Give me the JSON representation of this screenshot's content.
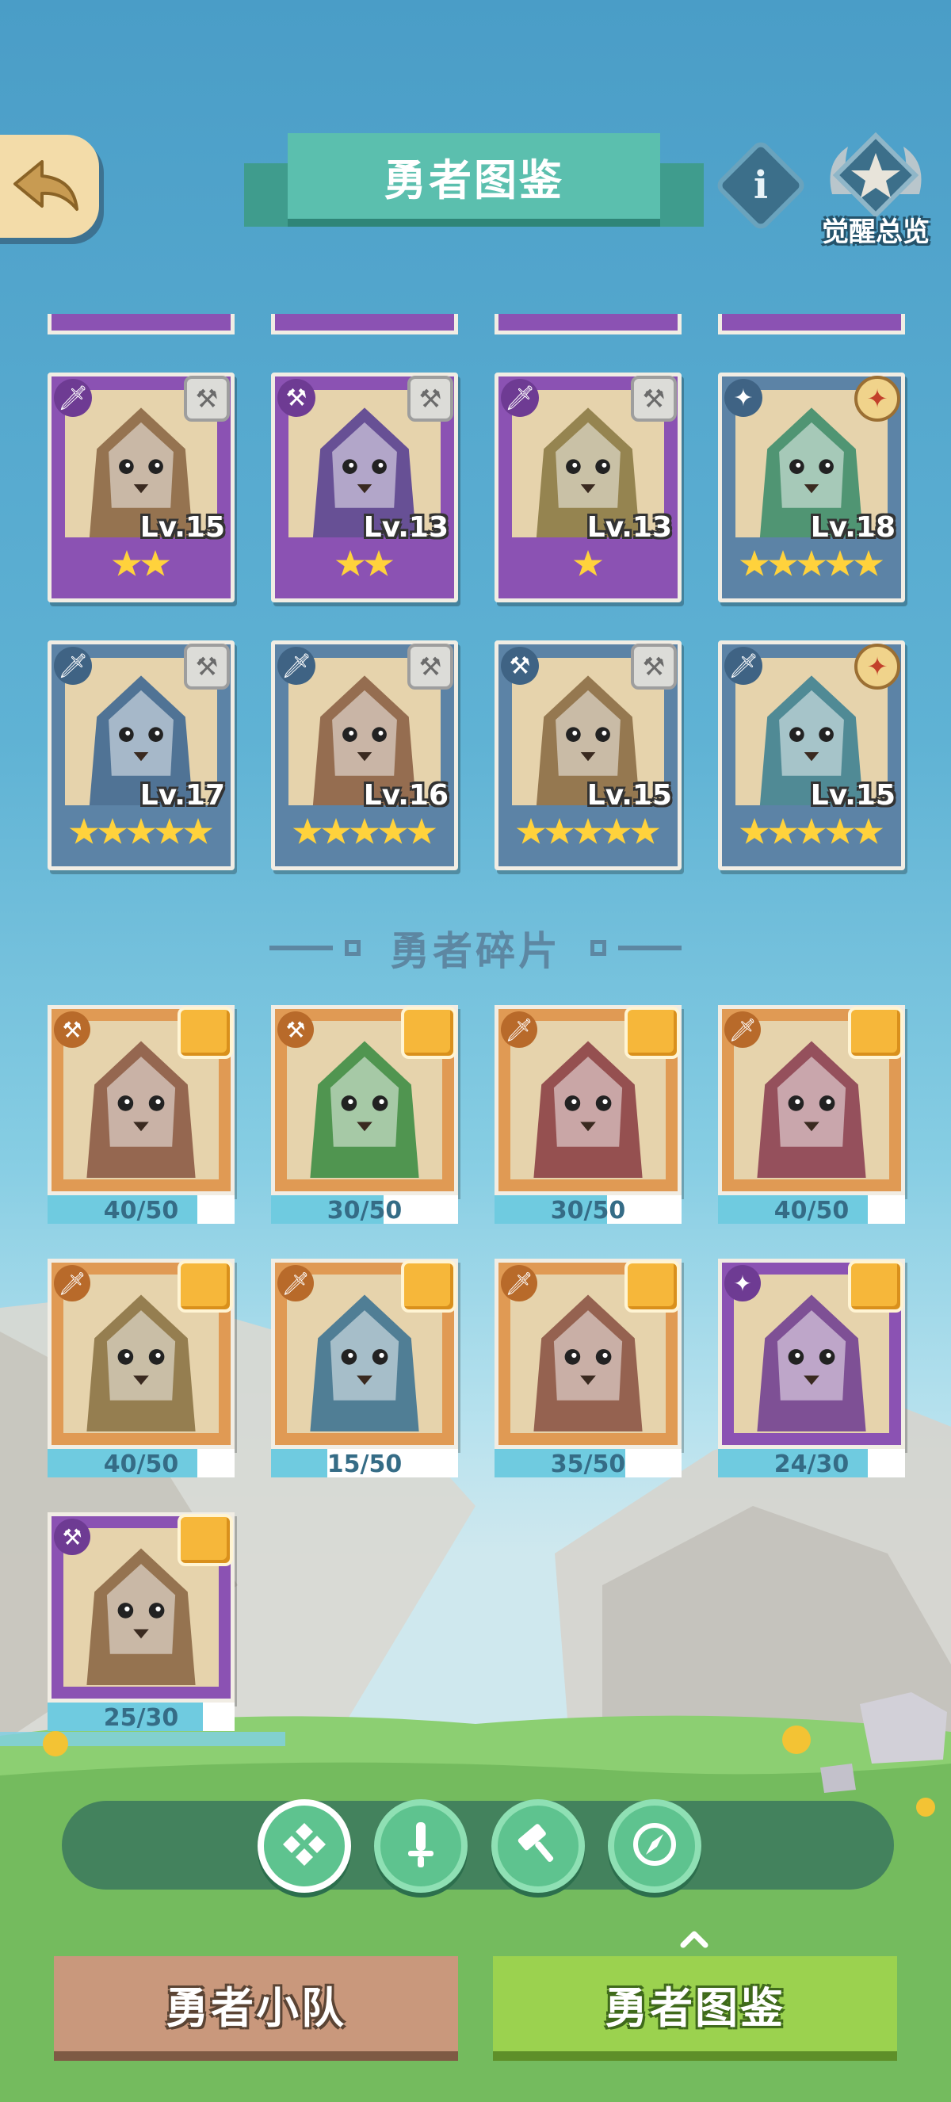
{
  "header": {
    "title": "勇者图鉴",
    "awaken_label": "觉醒总览",
    "info_glyph": "i"
  },
  "heroes": [
    {
      "level": "Lv.15",
      "stars": 2,
      "frame": "purple",
      "role": "sword",
      "weapon": "hammer",
      "portrait": "sheep-hero"
    },
    {
      "level": "Lv.13",
      "stars": 2,
      "frame": "purple",
      "role": "hammer",
      "weapon": "hammer",
      "portrait": "rhino-hero"
    },
    {
      "level": "Lv.13",
      "stars": 1,
      "frame": "purple",
      "role": "sword",
      "weapon": "hammer",
      "portrait": "goat-hero"
    },
    {
      "level": "Lv.18",
      "stars": 5,
      "frame": "blue",
      "role": "compass",
      "weapon": "compass",
      "portrait": "frog-hero"
    },
    {
      "level": "Lv.17",
      "stars": 5,
      "frame": "blue",
      "role": "sword",
      "weapon": "hammer",
      "portrait": "rabbit-hero"
    },
    {
      "level": "Lv.16",
      "stars": 5,
      "frame": "blue",
      "role": "sword",
      "weapon": "hammer",
      "portrait": "fox-hero"
    },
    {
      "level": "Lv.15",
      "stars": 5,
      "frame": "blue",
      "role": "hammer",
      "weapon": "hammer",
      "portrait": "deer-hero"
    },
    {
      "level": "Lv.15",
      "stars": 5,
      "frame": "blue",
      "role": "sword",
      "weapon": "compass",
      "portrait": "cat-hero"
    }
  ],
  "fragments_section": {
    "title": "勇者碎片"
  },
  "fragments": [
    {
      "count": "40/50",
      "progress": 0.8,
      "frame": "orange",
      "role": "hammer",
      "portrait": "walrus-hero"
    },
    {
      "count": "30/50",
      "progress": 0.6,
      "frame": "orange",
      "role": "hammer",
      "portrait": "crocodile-hero"
    },
    {
      "count": "30/50",
      "progress": 0.6,
      "frame": "orange",
      "role": "sword",
      "portrait": "ram-hero"
    },
    {
      "count": "40/50",
      "progress": 0.8,
      "frame": "orange",
      "role": "sword",
      "portrait": "dragon-hero"
    },
    {
      "count": "40/50",
      "progress": 0.8,
      "frame": "orange",
      "role": "sword",
      "portrait": "lynx-hero"
    },
    {
      "count": "15/50",
      "progress": 0.3,
      "frame": "orange",
      "role": "sword",
      "portrait": "wolf-hero"
    },
    {
      "count": "35/50",
      "progress": 0.7,
      "frame": "orange",
      "role": "sword",
      "portrait": "penguin-hero"
    },
    {
      "count": "24/30",
      "progress": 0.8,
      "frame": "purple",
      "role": "compass",
      "portrait": "ninja-goat-hero"
    },
    {
      "count": "25/30",
      "progress": 0.833,
      "frame": "purple",
      "role": "hammer",
      "portrait": "pangolin-hero"
    }
  ],
  "filters": [
    {
      "name": "all-filter",
      "icon": "diamond-grid-icon",
      "active": true
    },
    {
      "name": "sword-filter",
      "icon": "sword-icon",
      "active": false
    },
    {
      "name": "hammer-filter",
      "icon": "hammer-icon",
      "active": false
    },
    {
      "name": "compass-filter",
      "icon": "compass-icon",
      "active": false
    }
  ],
  "tabs": {
    "squad": "勇者小队",
    "gallery": "勇者图鉴"
  },
  "colors": {
    "purple_frame": "#8b52b3",
    "blue_frame": "#5c83a6",
    "orange_frame": "#e09a54",
    "star": "#ffd23c",
    "title_plate": "#5bbfae",
    "active_tab": "#9bd24f",
    "inactive_tab": "#c9987c"
  }
}
